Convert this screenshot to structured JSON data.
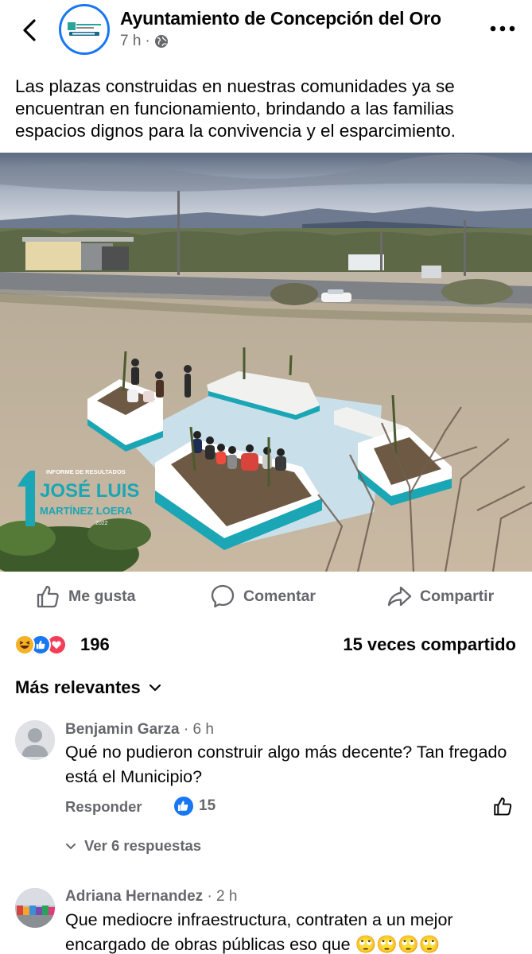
{
  "header": {
    "page_name": "Ayuntamiento de Concepción del Oro",
    "time": "7 h",
    "separator": "·",
    "back_icon": "chevron-left-icon",
    "privacy_icon": "globe-icon",
    "more_icon": "ellipsis-icon"
  },
  "post": {
    "text": "Las plazas construidas en nuestras comunidades ya se encuentran en funcionamiento, brindando a las familias espacios dignos para la convivencia y el esparcimiento.",
    "photo_watermark": {
      "line1": "INFORME DE RESULTADOS",
      "line2": "JOSÉ LUIS",
      "line3": "MARTÍNEZ LOERA",
      "year": "2022"
    }
  },
  "actions": {
    "like": "Me gusta",
    "comment": "Comentar",
    "share": "Compartir"
  },
  "stats": {
    "reaction_count": "196",
    "shares": "15 veces compartido",
    "reactions": [
      "haha",
      "like",
      "love"
    ]
  },
  "sort": {
    "label": "Más relevantes"
  },
  "comments": [
    {
      "author": "Benjamin Garza",
      "time": "· 6 h",
      "text": "Qué no pudieron construir algo más decente? Tan fregado está el Municipio?",
      "reply_label": "Responder",
      "likes": "15",
      "view_replies": "Ver 6 respuestas"
    },
    {
      "author": "Adriana Hernandez",
      "time": "· 2 h",
      "text": "Que mediocre infraestructura, contraten a un mejor encargado de obras públicas eso que 🙄🙄🙄🙄"
    }
  ],
  "colors": {
    "accent": "#1877f2",
    "secondary_text": "#65676b",
    "love": "#f33e58",
    "haha": "#f7b125"
  }
}
